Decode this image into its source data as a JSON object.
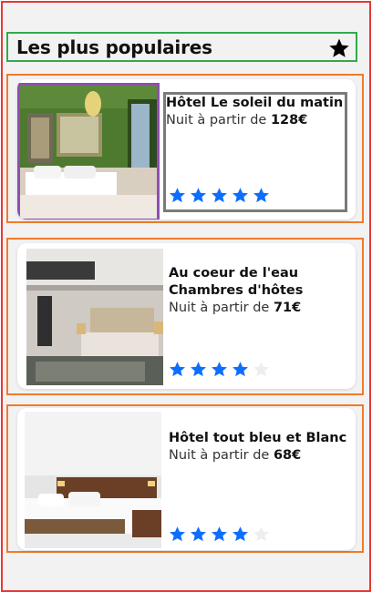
{
  "header": {
    "title": "Les plus populaires",
    "favorite_icon": "star-icon"
  },
  "hotels": [
    {
      "name": "Hôtel Le soleil du matin",
      "price_prefix": "Nuit à partir de ",
      "price": "128€",
      "rating": 5,
      "max_rating": 5
    },
    {
      "name": "Au coeur de l'eau Chambres d'hôtes",
      "price_prefix": "Nuit à partir de ",
      "price": "71€",
      "rating": 4,
      "max_rating": 5
    },
    {
      "name": "Hôtel tout bleu et Blanc",
      "price_prefix": "Nuit à partir de ",
      "price": "68€",
      "rating": 4,
      "max_rating": 5
    }
  ],
  "colors": {
    "star_filled": "#0d6efd",
    "star_empty": "#eeeeee",
    "accent_border": "#f07a2b"
  }
}
